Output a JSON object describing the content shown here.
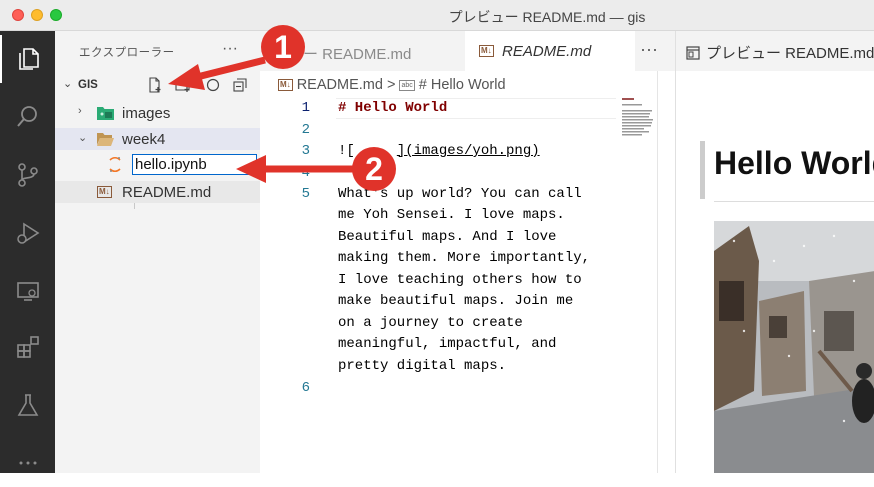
{
  "window": {
    "title": "プレビュー README.md — gis"
  },
  "sidebar": {
    "header": "エクスプローラー",
    "more": "···",
    "root_folder": "GIS",
    "items": [
      {
        "label": "images"
      },
      {
        "label": "week4"
      },
      {
        "label": "README.md"
      }
    ],
    "rename_input_value": "hello.ipynb"
  },
  "editor": {
    "tabs": [
      {
        "label": "ュー README.md"
      },
      {
        "label": "README.md"
      }
    ],
    "more": "···",
    "breadcrumb": {
      "file": "README.md",
      "sep": ">",
      "symbol": "# Hello World"
    },
    "line_numbers": [
      "1",
      "2",
      "3",
      "4",
      "5",
      "6"
    ],
    "lines": {
      "l1": "# Hello World",
      "l3a": "![",
      "l3b": "](images/yoh.png)",
      "l5": [
        "What's up world? You can call",
        "me Yoh Sensei. I love maps.",
        "Beautiful maps. And I love",
        "making them. More importantly,",
        "I love teaching others how to",
        "make beautiful maps. Join me",
        "on a journey to create",
        "meaningful, impactful, and",
        "pretty digital maps."
      ]
    }
  },
  "preview": {
    "tab_label": "プレビュー README.md",
    "heading": "Hello World"
  },
  "callouts": {
    "one": "1",
    "two": "2"
  },
  "colors": {
    "activity_bar": "#2c2c2c",
    "callout": "#e0332a",
    "heading": "#800000",
    "line_number": "#237893"
  }
}
